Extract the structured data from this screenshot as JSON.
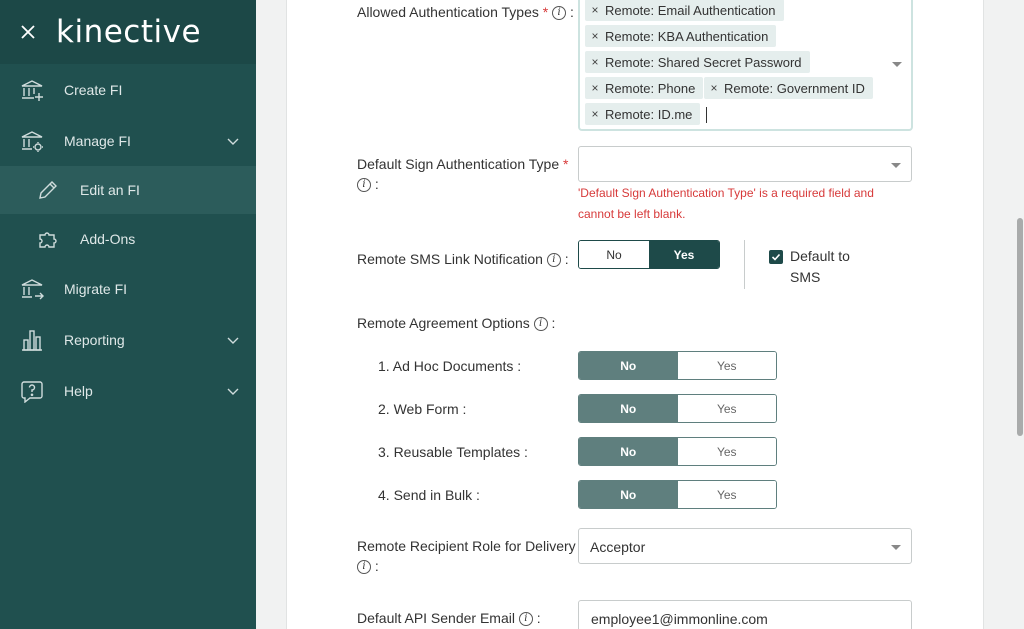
{
  "app": {
    "logo_text": "kinective"
  },
  "sidebar": {
    "items": [
      {
        "label": "Create FI",
        "icon": "bank-plus-icon"
      },
      {
        "label": "Manage FI",
        "icon": "bank-gear-icon"
      },
      {
        "label": "Edit an FI",
        "icon": "pencil-icon"
      },
      {
        "label": "Add-Ons",
        "icon": "puzzle-icon"
      },
      {
        "label": "Migrate FI",
        "icon": "bank-arrow-icon"
      },
      {
        "label": "Reporting",
        "icon": "bar-chart-icon"
      },
      {
        "label": "Help",
        "icon": "question-bubble-icon"
      }
    ]
  },
  "form": {
    "allowed_auth": {
      "label": "Allowed Authentication Types",
      "chips": [
        "Remote: Email Authentication",
        "Remote: KBA Authentication",
        "Remote: Shared Secret Password",
        "Remote: Phone",
        "Remote: Government ID",
        "Remote: ID.me"
      ]
    },
    "default_sign_auth": {
      "label": "Default Sign Authentication Type",
      "value": "",
      "error": "'Default Sign Authentication Type' is a required field and cannot be left blank."
    },
    "remote_sms": {
      "label": "Remote SMS Link Notification",
      "no": "No",
      "yes": "Yes",
      "selected": "Yes",
      "default_checkbox_label": "Default to SMS",
      "default_checked": true
    },
    "remote_agreement": {
      "label": "Remote Agreement Options",
      "options": [
        {
          "label": "1. Ad Hoc Documents :",
          "no": "No",
          "yes": "Yes",
          "selected": "No"
        },
        {
          "label": "2. Web Form :",
          "no": "No",
          "yes": "Yes",
          "selected": "No"
        },
        {
          "label": "3. Reusable Templates :",
          "no": "No",
          "yes": "Yes",
          "selected": "No"
        },
        {
          "label": "4. Send in Bulk :",
          "no": "No",
          "yes": "Yes",
          "selected": "No"
        }
      ]
    },
    "recipient_role": {
      "label": "Remote Recipient Role for Delivery",
      "value": "Acceptor"
    },
    "api_sender": {
      "label": "Default API Sender Email",
      "value": "employee1@immonline.com"
    }
  },
  "colors": {
    "sidebar_bg": "#20504f",
    "accent": "#1e4a49",
    "error": "#d73a3a"
  }
}
